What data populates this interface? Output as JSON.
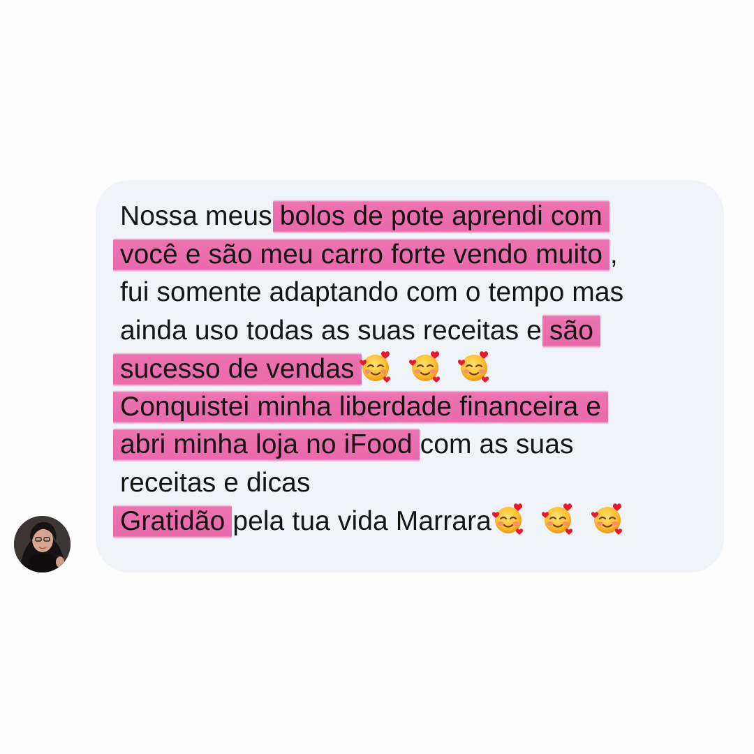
{
  "message": {
    "lines": [
      {
        "segments": [
          {
            "text": "Nossa meus ",
            "highlight": false
          },
          {
            "text": "bolos de pote aprendi com",
            "highlight": true
          }
        ]
      },
      {
        "segments": [
          {
            "text": "você e são meu carro forte vendo muito",
            "highlight": true
          },
          {
            "text": " ,",
            "highlight": false
          }
        ]
      },
      {
        "segments": [
          {
            "text": "fui somente adaptando com o tempo mas",
            "highlight": false
          }
        ]
      },
      {
        "segments": [
          {
            "text": "ainda uso todas as suas receitas e ",
            "highlight": false
          },
          {
            "text": "são",
            "highlight": true
          }
        ]
      },
      {
        "segments": [
          {
            "text": "sucesso de vendas",
            "highlight": true
          }
        ],
        "emoji_count": 3
      },
      {
        "segments": [
          {
            "text": "Conquistei minha liberdade financeira e",
            "highlight": true
          }
        ]
      },
      {
        "segments": [
          {
            "text": "abri minha loja no iFood",
            "highlight": true
          },
          {
            "text": " com as suas",
            "highlight": false
          }
        ]
      },
      {
        "segments": [
          {
            "text": "receitas e dicas",
            "highlight": false
          }
        ]
      },
      {
        "segments": [
          {
            "text": "Gratidão",
            "highlight": true
          },
          {
            "text": " pela tua vida Marrara",
            "highlight": false
          }
        ],
        "emoji_count": 3
      }
    ],
    "emoji_icon": "smiling-face-with-hearts-icon",
    "highlight_color": "#ec68aa",
    "bubble_color": "#f0f3f7",
    "text_color": "#141414"
  },
  "sender": {
    "avatar_icon": "user-avatar"
  }
}
